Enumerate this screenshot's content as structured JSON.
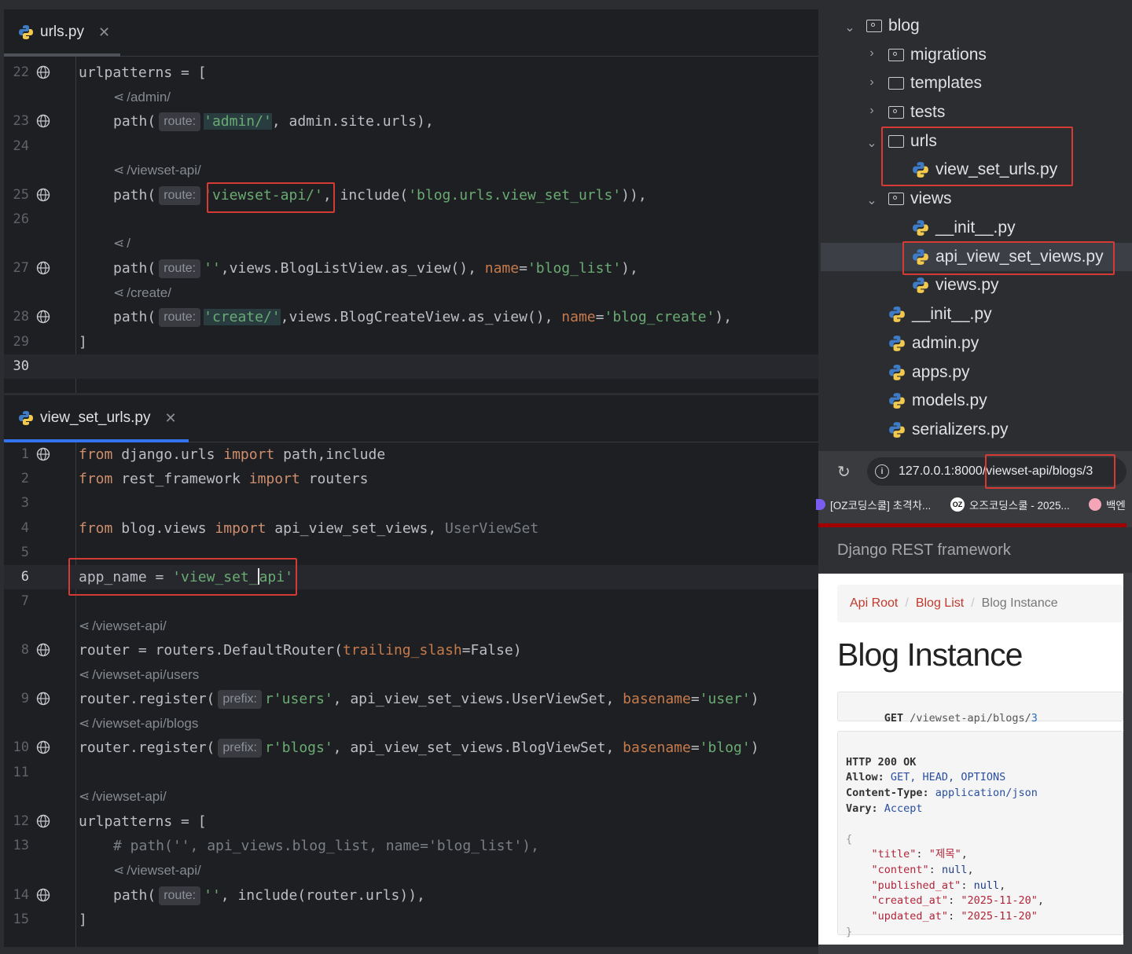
{
  "editor_top": {
    "tab_title": "urls.py",
    "lines": [
      {
        "n": "22"
      },
      {
        "n": "23"
      },
      {
        "n": "24"
      },
      {
        "n": "25"
      },
      {
        "n": "26"
      },
      {
        "n": "27"
      },
      {
        "n": "28"
      },
      {
        "n": "29"
      },
      {
        "n": "30"
      }
    ],
    "hints": {
      "admin": "/admin/",
      "viewset": "/viewset-api/",
      "root": "/",
      "create": "/create/"
    },
    "inlay_route": "route:",
    "code": {
      "l22": "urlpatterns = [",
      "l23_a": "path(",
      "l23_b": "'admin/'",
      "l23_c": ", admin.site.urls),",
      "l25_a": "path(",
      "l25_b": "'viewset-api/'",
      "l25_c": ", include(",
      "l25_d": "'blog.urls.view_set_urls'",
      "l25_e": ")),",
      "l27_a": "path(",
      "l27_b": "''",
      "l27_c": ",views.BlogListView.as_view(), ",
      "l27_d": "name",
      "l27_e": "=",
      "l27_f": "'blog_list'",
      "l27_g": "),",
      "l28_a": "path(",
      "l28_b": "'create/'",
      "l28_c": ",views.BlogCreateView.as_view(), ",
      "l28_d": "name",
      "l28_e": "=",
      "l28_f": "'blog_create'",
      "l28_g": "),",
      "l29": "]"
    }
  },
  "editor_bottom": {
    "tab_title": "view_set_urls.py",
    "lines": [
      "1",
      "2",
      "3",
      "4",
      "5",
      "6",
      "7",
      "8",
      "9",
      "10",
      "11",
      "12",
      "13",
      "14",
      "15"
    ],
    "inlay_prefix": "prefix:",
    "inlay_route": "route:",
    "hints": {
      "h7": "/viewset-api/",
      "h8": "/viewset-api/users",
      "h9": "/viewset-api/blogs",
      "h11": "/viewset-api/",
      "h13": "/viewset-api/"
    },
    "code": {
      "l1_kw1": "from",
      "l1_a": " django.urls ",
      "l1_kw2": "import",
      "l1_b": " path,include",
      "l2_kw1": "from",
      "l2_a": " rest_framework ",
      "l2_kw2": "import",
      "l2_b": " routers",
      "l4_kw1": "from",
      "l4_a": " blog.views ",
      "l4_kw2": "import",
      "l4_b": " api_view_set_views, ",
      "l4_c": "UserViewSet",
      "l6_a": "app_name = ",
      "l6_b": "'view_set_",
      "l6_c": "api'",
      "l8_a": "router = routers.DefaultRouter(",
      "l8_b": "trailing_slash",
      "l8_c": "=False)",
      "l9_a": "router.register(",
      "l9_b": "r'users'",
      "l9_c": ", api_view_set_views.UserViewSet, ",
      "l9_d": "basename",
      "l9_e": "=",
      "l9_f": "'user'",
      "l9_g": ")",
      "l10_a": "router.register(",
      "l10_b": "r'blogs'",
      "l10_c": ", api_view_set_views.BlogViewSet, ",
      "l10_d": "basename",
      "l10_e": "=",
      "l10_f": "'blog'",
      "l10_g": ")",
      "l12": "urlpatterns = [",
      "l13": "# path('', api_views.blog_list, name='blog_list'),",
      "l14_a": "path(",
      "l14_b": "''",
      "l14_c": ", include(router.urls)),",
      "l15": "]"
    }
  },
  "project_tree": {
    "blog": "blog",
    "migrations": "migrations",
    "templates": "templates",
    "tests": "tests",
    "urls": "urls",
    "view_set_urls": "view_set_urls.py",
    "views": "views",
    "views_init": "__init__.py",
    "api_views": "api_view_set_views.py",
    "views_py": "views.py",
    "init": "__init__.py",
    "admin": "admin.py",
    "apps": "apps.py",
    "models": "models.py",
    "serializers": "serializers.py"
  },
  "browser": {
    "url_host": "127.0.0.1:8000",
    "url_path": "/viewset-api/blogs/3",
    "bookmarks": [
      "[OZ코딩스쿨] 초격차...",
      "오즈코딩스쿨 - 2025...",
      "백엔"
    ],
    "bookmark_oz": "OZ",
    "drf_brand": "Django REST framework",
    "breadcrumb": [
      "Api Root",
      "Blog List",
      "Blog Instance"
    ],
    "breadcrumb_sep": "/",
    "heading": "Blog Instance",
    "request_method": "GET",
    "request_path": " /viewset-api/blogs/",
    "request_id": "3",
    "response": {
      "status": "HTTP 200 OK",
      "allow_key": "Allow:",
      "allow_val": " GET, HEAD, OPTIONS",
      "ct_key": "Content-Type:",
      "ct_val": " application/json",
      "vary_key": "Vary:",
      "vary_val": " Accept",
      "open": "{",
      "fields": [
        {
          "k": "\"title\"",
          "v": "\"제목\"",
          "sep": ","
        },
        {
          "k": "\"content\"",
          "v": "null",
          "sep": ","
        },
        {
          "k": "\"published_at\"",
          "v": "null",
          "sep": ","
        },
        {
          "k": "\"created_at\"",
          "v": "\"2025-11-20\"",
          "sep": ","
        },
        {
          "k": "\"updated_at\"",
          "v": "\"2025-11-20\"",
          "sep": ""
        }
      ],
      "close": "}"
    }
  },
  "colors": {
    "accent": "#3574f0",
    "highlight_box": "#d63a35",
    "keyword": "#cf8e6d",
    "string": "#6aab73",
    "param": "#c77b4c",
    "link": "#c0392b"
  }
}
